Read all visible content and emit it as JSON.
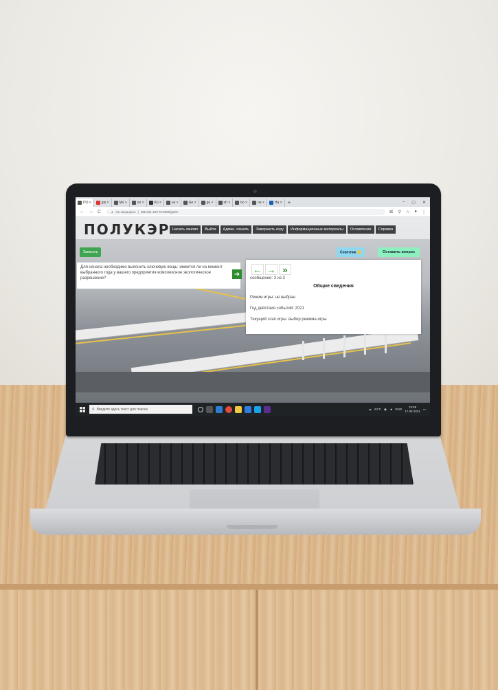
{
  "browser": {
    "tabs": [
      {
        "label": "ПО ×",
        "active": true
      },
      {
        "label": "gis ×"
      },
      {
        "label": "Mo ×"
      },
      {
        "label": "on ×"
      },
      {
        "label": "Ko ×"
      },
      {
        "label": "se ×"
      },
      {
        "label": "Ge ×"
      },
      {
        "label": "ge ×"
      },
      {
        "label": "sh ×"
      },
      {
        "label": "bo ×"
      },
      {
        "label": "ne ×"
      },
      {
        "label": "Ha ×"
      }
    ],
    "new_tab": "+",
    "window_controls": [
      "–",
      "▢",
      "✕"
    ],
    "url_security": "Не защищено",
    "url": "185.221.153.79:3000/game"
  },
  "app": {
    "logo": "ПОЛУКЭР",
    "menu": [
      "Начать заново",
      "Выйти",
      "Админ. панель",
      "Завершить игру",
      "Информационные материалы",
      "Оглавление",
      "Справка"
    ],
    "save_button": "Записать",
    "advice_button": "Советник",
    "question_button": "Оставить вопрос",
    "question_text": "Для начала необходимо выяснить ключевую вещь: имеется ли на момент выбранного года у вашего предприятия комплексное экологическое разрешение?",
    "panel": {
      "counter": "сообщение: 3 из 3",
      "title": "Общие сведения",
      "lines": [
        "Режим игры: не выбран",
        "Год действия событий: 2021",
        "Текущий этап игры: выбор режима игры"
      ]
    }
  },
  "taskbar": {
    "search_placeholder": "Введите здесь текст для поиска",
    "weather": "24°C",
    "lang": "ENG",
    "time": "13:58",
    "date": "17.08.2021"
  }
}
